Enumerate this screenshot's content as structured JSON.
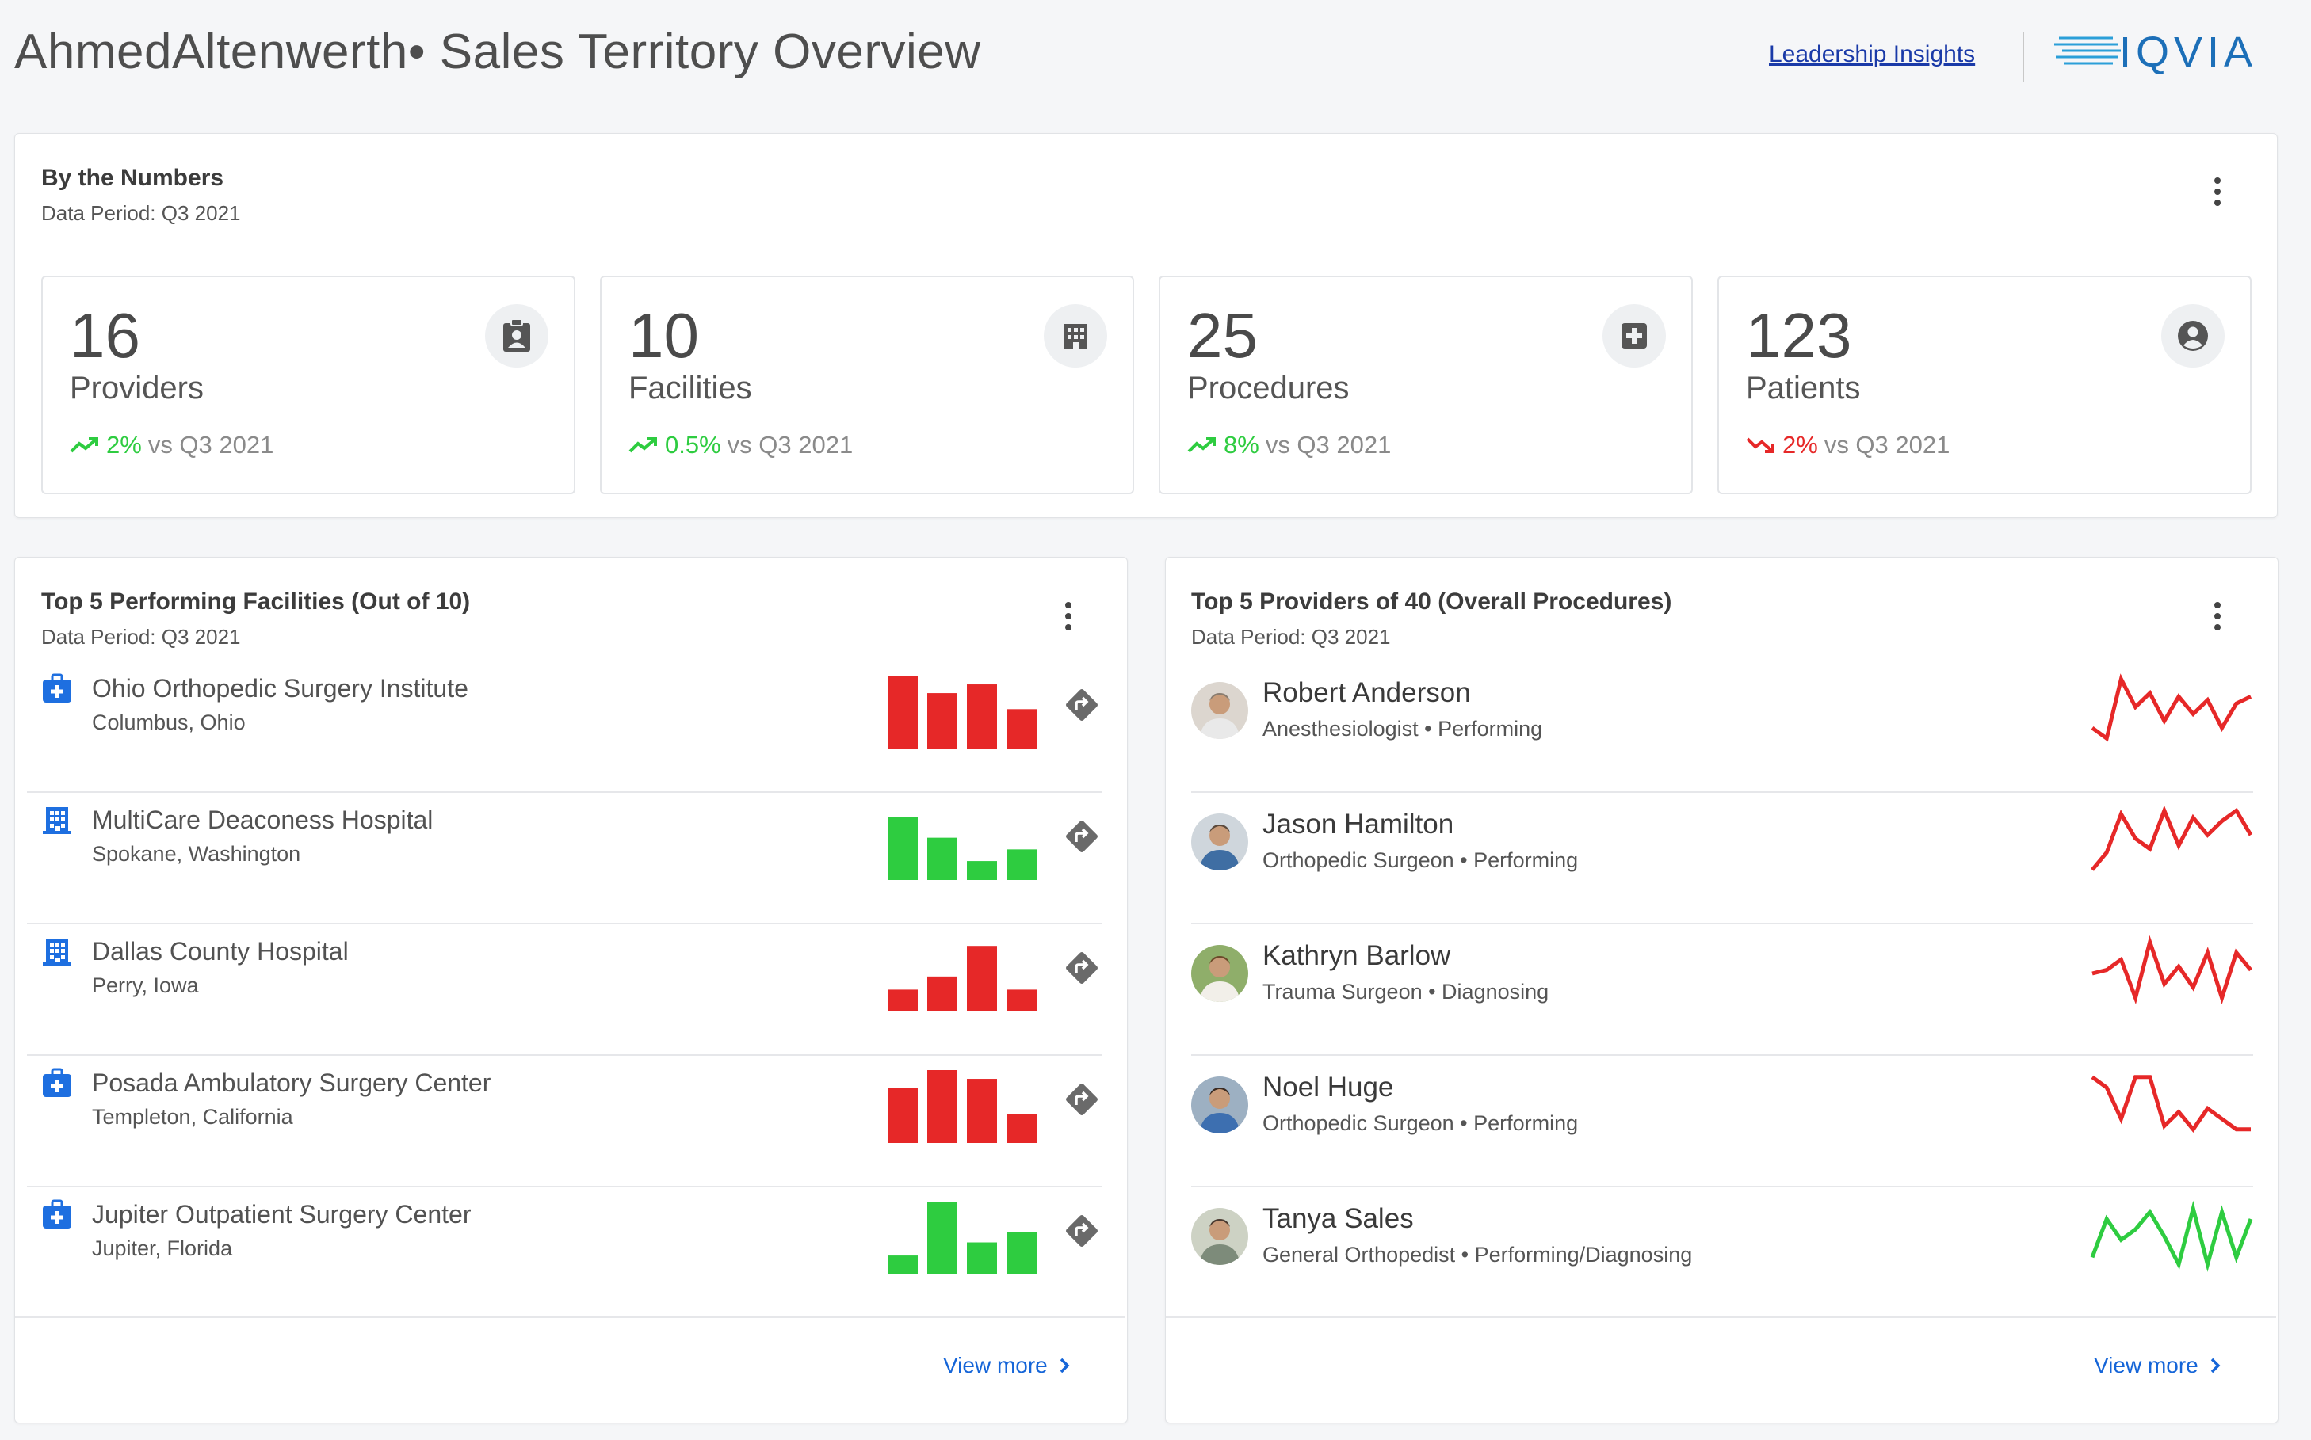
{
  "header": {
    "title": "AhmedAltenwerth• Sales Territory Overview",
    "link": "Leadership Insights",
    "logo_text": "IQVIA"
  },
  "numbers": {
    "title": "By the Numbers",
    "period": "Data Period: Q3 2021",
    "stats": [
      {
        "value": "16",
        "label": "Providers",
        "change": "2%",
        "compare": "vs Q3 2021",
        "direction": "up",
        "icon": "provider-badge-icon"
      },
      {
        "value": "10",
        "label": "Facilities",
        "change": "0.5%",
        "compare": "vs Q3 2021",
        "direction": "up",
        "icon": "building-icon"
      },
      {
        "value": "25",
        "label": "Procedures",
        "change": "8%",
        "compare": "vs Q3 2021",
        "direction": "up",
        "icon": "medical-plus-icon"
      },
      {
        "value": "123",
        "label": "Patients",
        "change": "2%",
        "compare": "vs Q3 2021",
        "direction": "down",
        "icon": "person-icon"
      }
    ]
  },
  "facilities": {
    "title": "Top 5 Performing Facilities (Out of 10)",
    "period": "Data Period: Q3 2021",
    "view_more": "View more",
    "items": [
      {
        "name": "Ohio Orthopedic Surgery Institute",
        "location": "Columbus, Ohio",
        "type": "medical-kit-icon",
        "color": "#e62828",
        "bars": [
          1.0,
          0.76,
          0.88,
          0.54
        ]
      },
      {
        "name": "MultiCare Deaconess Hospital",
        "location": "Spokane, Washington",
        "type": "building-icon",
        "color": "#2ecc40",
        "bars": [
          0.86,
          0.58,
          0.26,
          0.42
        ]
      },
      {
        "name": "Dallas County Hospital",
        "location": "Perry, Iowa",
        "type": "building-icon",
        "color": "#e62828",
        "bars": [
          0.3,
          0.48,
          0.9,
          0.3
        ]
      },
      {
        "name": "Posada Ambulatory Surgery Center",
        "location": "Templeton, California",
        "type": "medical-kit-icon",
        "color": "#e62828",
        "bars": [
          0.76,
          1.0,
          0.88,
          0.4
        ]
      },
      {
        "name": "Jupiter Outpatient Surgery Center",
        "location": "Jupiter, Florida",
        "type": "medical-kit-icon",
        "color": "#2ecc40",
        "bars": [
          0.26,
          1.0,
          0.44,
          0.58
        ]
      }
    ]
  },
  "providers": {
    "title": "Top 5 Providers of 40 (Overall Procedures)",
    "period": "Data Period: Q3 2021",
    "view_more": "View more",
    "items": [
      {
        "name": "Robert Anderson",
        "role": "Anesthesiologist • Performing",
        "color": "#e62828",
        "trend": [
          0.25,
          0.1,
          0.95,
          0.55,
          0.75,
          0.35,
          0.7,
          0.45,
          0.65,
          0.25,
          0.6,
          0.7
        ]
      },
      {
        "name": "Jason Hamilton",
        "role": "Orthopedic Surgeon • Performing",
        "color": "#e62828",
        "trend": [
          0.1,
          0.35,
          0.9,
          0.55,
          0.4,
          0.95,
          0.45,
          0.85,
          0.6,
          0.8,
          0.95,
          0.6
        ]
      },
      {
        "name": "Kathryn Barlow",
        "role": "Trauma Surgeon • Diagnosing",
        "color": "#e62828",
        "trend": [
          0.5,
          0.55,
          0.7,
          0.15,
          0.95,
          0.35,
          0.6,
          0.3,
          0.8,
          0.15,
          0.8,
          0.55
        ]
      },
      {
        "name": "Noel Huge",
        "role": "Orthopedic Surgeon • Performing",
        "color": "#e62828",
        "trend": [
          0.9,
          0.75,
          0.3,
          0.9,
          0.9,
          0.2,
          0.4,
          0.15,
          0.45,
          0.3,
          0.15,
          0.15
        ]
      },
      {
        "name": "Tanya Sales",
        "role": "General Orthopedist • Performing/Diagnosing",
        "color": "#2ecc40",
        "trend": [
          0.2,
          0.75,
          0.45,
          0.6,
          0.85,
          0.5,
          0.1,
          0.9,
          0.1,
          0.85,
          0.2,
          0.75
        ]
      }
    ]
  }
}
